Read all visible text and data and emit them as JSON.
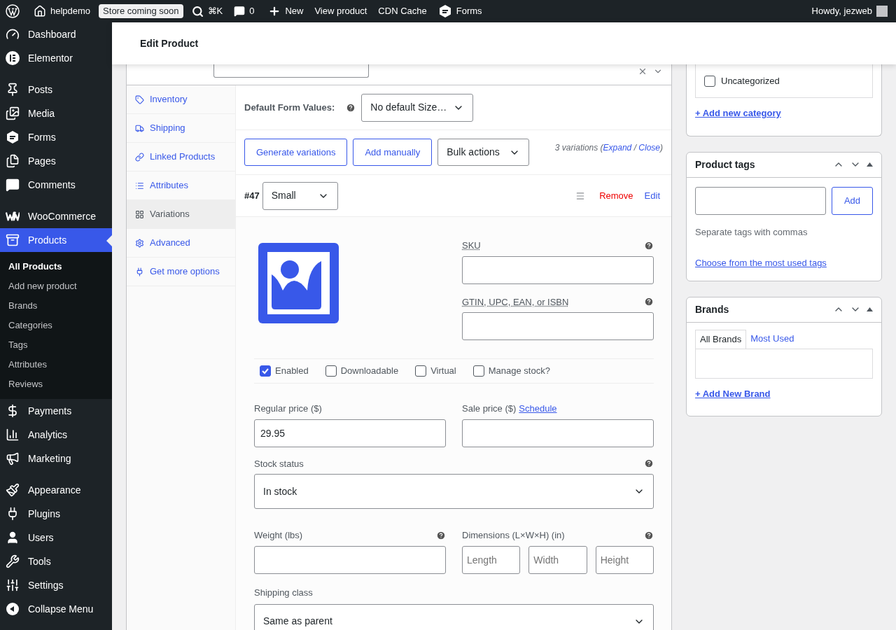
{
  "admin_bar": {
    "site": "helpdemo",
    "badge": "Store coming soon",
    "shortcut": "⌘K",
    "comments": "0",
    "new": "New",
    "links": [
      "View product",
      "CDN Cache",
      "Forms"
    ],
    "greeting": "Howdy, jezweb"
  },
  "sidebar": {
    "groups": [
      {
        "items": [
          {
            "label": "Dashboard",
            "selected": false
          },
          {
            "label": "Elementor",
            "selected": false
          }
        ]
      },
      {
        "items": [
          {
            "label": "Posts",
            "selected": false
          },
          {
            "label": "Media",
            "selected": false
          },
          {
            "label": "Forms",
            "selected": false
          },
          {
            "label": "Pages",
            "selected": false
          },
          {
            "label": "Comments",
            "selected": false
          }
        ]
      },
      {
        "items": [
          {
            "label": "WooCommerce",
            "selected": false
          },
          {
            "label": "Products",
            "selected": true,
            "children": [
              {
                "label": "All Products",
                "selected": true
              },
              {
                "label": "Add new product",
                "selected": false
              },
              {
                "label": "Brands",
                "selected": false
              },
              {
                "label": "Categories",
                "selected": false
              },
              {
                "label": "Tags",
                "selected": false
              },
              {
                "label": "Attributes",
                "selected": false
              },
              {
                "label": "Reviews",
                "selected": false
              }
            ]
          }
        ]
      },
      {
        "items": [
          {
            "label": "Payments",
            "selected": false
          },
          {
            "label": "Analytics",
            "selected": false
          },
          {
            "label": "Marketing",
            "selected": false
          }
        ]
      },
      {
        "items": [
          {
            "label": "Appearance",
            "selected": false
          },
          {
            "label": "Plugins",
            "selected": false
          },
          {
            "label": "Users",
            "selected": false
          },
          {
            "label": "Tools",
            "selected": false
          },
          {
            "label": "Settings",
            "selected": false
          },
          {
            "label": "Collapse Menu",
            "selected": false
          }
        ]
      }
    ]
  },
  "page_title": "Edit Product",
  "product_data": {
    "tabs": [
      {
        "label": "Inventory",
        "selected": false
      },
      {
        "label": "Shipping",
        "selected": false
      },
      {
        "label": "Linked Products",
        "selected": false
      },
      {
        "label": "Attributes",
        "selected": false
      },
      {
        "label": "Variations",
        "selected": true
      },
      {
        "label": "Advanced",
        "selected": false
      },
      {
        "label": "Get more options",
        "selected": false
      }
    ],
    "default_form": {
      "label": "Default Form Values:",
      "value": "No default Size…"
    },
    "buttons": [
      "Generate variations",
      "Add manually"
    ],
    "bulk_actions": "Bulk actions",
    "summary": {
      "text": "3 variations",
      "open": "(",
      "links": [
        "Expand",
        "Close"
      ],
      "separator": "/",
      "end": ")"
    },
    "variation": {
      "number": "#47",
      "attribute": "Small",
      "remove": "Remove",
      "edit": "Edit",
      "sku_label": "SKU",
      "gtin_label": "GTIN, UPC, EAN, or ISBN",
      "options": [
        {
          "label": "Enabled",
          "checked": true
        },
        {
          "label": "Downloadable",
          "checked": false
        },
        {
          "label": "Virtual",
          "checked": false
        },
        {
          "label": "Manage stock?",
          "checked": false
        }
      ],
      "regular_price": {
        "label": "Regular price ($)",
        "value": "29.95"
      },
      "sale_price": {
        "label": "Sale price ($)",
        "link": "Schedule"
      },
      "stock_status": {
        "label": "Stock status",
        "value": "In stock"
      },
      "weight": {
        "label": "Weight (lbs)"
      },
      "dimensions": {
        "label": "Dimensions (L×W×H) (in)",
        "placeholders": [
          "Length",
          "Width",
          "Height"
        ]
      },
      "shipping_class": {
        "label": "Shipping class",
        "value": "Same as parent"
      }
    }
  },
  "categories": {
    "items": [
      {
        "label": "Uncategorized",
        "checked": false
      }
    ],
    "add_link": "+ Add new category"
  },
  "tags": {
    "title": "Product tags",
    "button": "Add",
    "hint": "Separate tags with commas",
    "link": "Choose from the most used tags"
  },
  "brands": {
    "title": "Brands",
    "tabs": [
      {
        "label": "All Brands",
        "selected": true
      },
      {
        "label": "Most Used",
        "selected": false
      }
    ],
    "add_link": "+ Add New Brand"
  }
}
